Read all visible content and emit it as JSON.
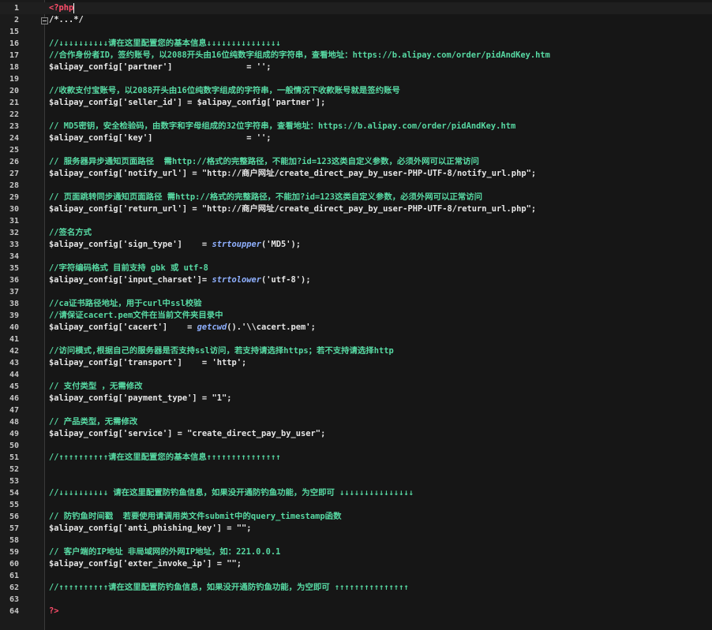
{
  "editor": {
    "language": "php",
    "colors": {
      "background": "#161616",
      "gutter_background": "#1b1b1b",
      "line_number": "#c8c8c8",
      "code_text": "#e6e6e6",
      "comment": "#57d9a3",
      "php_tag": "#ff4d6a",
      "function": "#8fb0ff"
    },
    "lines": [
      {
        "n": "1",
        "type": "tag",
        "text": "<?php"
      },
      {
        "n": "2",
        "type": "fold",
        "text": "/*...*/"
      },
      {
        "n": "15",
        "type": "blank",
        "text": ""
      },
      {
        "n": "16",
        "type": "comment",
        "text": "//↓↓↓↓↓↓↓↓↓↓请在这里配置您的基本信息↓↓↓↓↓↓↓↓↓↓↓↓↓↓↓"
      },
      {
        "n": "17",
        "type": "comment",
        "text": "//合作身份者ID，签约账号，以2088开头由16位纯数字组成的字符串，查看地址：https://b.alipay.com/order/pidAndKey.htm"
      },
      {
        "n": "18",
        "type": "code",
        "text": "$alipay_config['partner']\t\t= '';"
      },
      {
        "n": "19",
        "type": "blank",
        "text": ""
      },
      {
        "n": "20",
        "type": "comment",
        "text": "//收款支付宝账号，以2088开头由16位纯数字组成的字符串，一般情况下收款账号就是签约账号"
      },
      {
        "n": "21",
        "type": "code",
        "text": "$alipay_config['seller_id'] = $alipay_config['partner'];"
      },
      {
        "n": "22",
        "type": "blank",
        "text": ""
      },
      {
        "n": "23",
        "type": "comment",
        "text": "// MD5密钥，安全检验码，由数字和字母组成的32位字符串，查看地址：https://b.alipay.com/order/pidAndKey.htm"
      },
      {
        "n": "24",
        "type": "code",
        "text": "$alipay_config['key']\t\t\t= '';"
      },
      {
        "n": "25",
        "type": "blank",
        "text": ""
      },
      {
        "n": "26",
        "type": "comment",
        "text": "// 服务器异步通知页面路径  需http://格式的完整路径，不能加?id=123这类自定义参数，必须外网可以正常访问"
      },
      {
        "n": "27",
        "type": "code",
        "text": "$alipay_config['notify_url'] = \"http://商户网址/create_direct_pay_by_user-PHP-UTF-8/notify_url.php\";"
      },
      {
        "n": "28",
        "type": "blank",
        "text": ""
      },
      {
        "n": "29",
        "type": "comment",
        "text": "// 页面跳转同步通知页面路径 需http://格式的完整路径，不能加?id=123这类自定义参数，必须外网可以正常访问"
      },
      {
        "n": "30",
        "type": "code",
        "text": "$alipay_config['return_url'] = \"http://商户网址/create_direct_pay_by_user-PHP-UTF-8/return_url.php\";"
      },
      {
        "n": "31",
        "type": "blank",
        "text": ""
      },
      {
        "n": "32",
        "type": "comment",
        "text": "//签名方式"
      },
      {
        "n": "33",
        "type": "call",
        "pre": "$alipay_config['sign_type']    = ",
        "fn": "strtoupper",
        "post": "('MD5');"
      },
      {
        "n": "34",
        "type": "blank",
        "text": ""
      },
      {
        "n": "35",
        "type": "comment",
        "text": "//字符编码格式 目前支持 gbk 或 utf-8"
      },
      {
        "n": "36",
        "type": "call",
        "pre": "$alipay_config['input_charset']= ",
        "fn": "strtolower",
        "post": "('utf-8');"
      },
      {
        "n": "37",
        "type": "blank",
        "text": ""
      },
      {
        "n": "38",
        "type": "comment",
        "text": "//ca证书路径地址，用于curl中ssl校验"
      },
      {
        "n": "39",
        "type": "comment",
        "text": "//请保证cacert.pem文件在当前文件夹目录中"
      },
      {
        "n": "40",
        "type": "call",
        "pre": "$alipay_config['cacert']    = ",
        "fn": "getcwd",
        "post": "().'\\\\cacert.pem';"
      },
      {
        "n": "41",
        "type": "blank",
        "text": ""
      },
      {
        "n": "42",
        "type": "comment",
        "text": "//访问模式,根据自己的服务器是否支持ssl访问，若支持请选择https；若不支持请选择http"
      },
      {
        "n": "43",
        "type": "code",
        "text": "$alipay_config['transport']    = 'http';"
      },
      {
        "n": "44",
        "type": "blank",
        "text": ""
      },
      {
        "n": "45",
        "type": "comment",
        "text": "// 支付类型 ，无需修改"
      },
      {
        "n": "46",
        "type": "code",
        "text": "$alipay_config['payment_type'] = \"1\";"
      },
      {
        "n": "47",
        "type": "blank",
        "text": ""
      },
      {
        "n": "48",
        "type": "comment",
        "text": "// 产品类型，无需修改"
      },
      {
        "n": "49",
        "type": "code",
        "text": "$alipay_config['service'] = \"create_direct_pay_by_user\";"
      },
      {
        "n": "50",
        "type": "blank",
        "text": ""
      },
      {
        "n": "51",
        "type": "comment",
        "text": "//↑↑↑↑↑↑↑↑↑↑请在这里配置您的基本信息↑↑↑↑↑↑↑↑↑↑↑↑↑↑↑"
      },
      {
        "n": "52",
        "type": "blank",
        "text": ""
      },
      {
        "n": "53",
        "type": "blank",
        "text": ""
      },
      {
        "n": "54",
        "type": "comment",
        "text": "//↓↓↓↓↓↓↓↓↓↓ 请在这里配置防钓鱼信息，如果没开通防钓鱼功能，为空即可 ↓↓↓↓↓↓↓↓↓↓↓↓↓↓↓"
      },
      {
        "n": "55",
        "type": "blank",
        "text": ""
      },
      {
        "n": "56",
        "type": "comment",
        "text": "// 防钓鱼时间戳  若要使用请调用类文件submit中的query_timestamp函数"
      },
      {
        "n": "57",
        "type": "code",
        "text": "$alipay_config['anti_phishing_key'] = \"\";"
      },
      {
        "n": "58",
        "type": "blank",
        "text": ""
      },
      {
        "n": "59",
        "type": "comment",
        "text": "// 客户端的IP地址 非局域网的外网IP地址，如：221.0.0.1"
      },
      {
        "n": "60",
        "type": "code",
        "text": "$alipay_config['exter_invoke_ip'] = \"\";"
      },
      {
        "n": "61",
        "type": "blank",
        "text": ""
      },
      {
        "n": "62",
        "type": "comment",
        "text": "//↑↑↑↑↑↑↑↑↑↑请在这里配置防钓鱼信息，如果没开通防钓鱼功能，为空即可 ↑↑↑↑↑↑↑↑↑↑↑↑↑↑↑"
      },
      {
        "n": "63",
        "type": "blank",
        "text": ""
      },
      {
        "n": "64",
        "type": "tag",
        "text": "?>"
      }
    ]
  }
}
